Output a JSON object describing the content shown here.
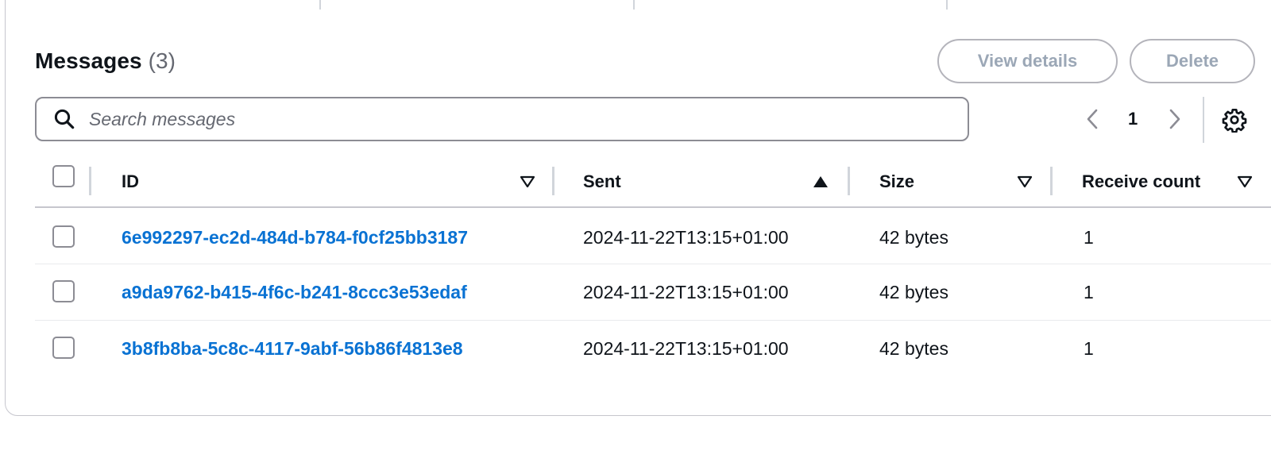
{
  "header": {
    "title": "Messages",
    "count": "(3)",
    "view_details_label": "View details",
    "delete_label": "Delete"
  },
  "search": {
    "placeholder": "Search messages",
    "value": ""
  },
  "pagination": {
    "current_page": "1"
  },
  "table": {
    "columns": [
      {
        "label": "ID",
        "sort": "none"
      },
      {
        "label": "Sent",
        "sort": "ascending"
      },
      {
        "label": "Size",
        "sort": "none"
      },
      {
        "label": "Receive count",
        "sort": "none"
      }
    ],
    "rows": [
      {
        "id": "6e992297-ec2d-484d-b784-f0cf25bb3187",
        "sent": "2024-11-22T13:15+01:00",
        "size": "42 bytes",
        "receive_count": "1"
      },
      {
        "id": "a9da9762-b415-4f6c-b241-8ccc3e53edaf",
        "sent": "2024-11-22T13:15+01:00",
        "size": "42 bytes",
        "receive_count": "1"
      },
      {
        "id": "3b8fb8ba-5c8c-4117-9abf-56b86f4813e8",
        "sent": "2024-11-22T13:15+01:00",
        "size": "42 bytes",
        "receive_count": "1"
      }
    ]
  },
  "colors": {
    "link": "#0972d3",
    "text": "#0f141a",
    "muted": "#656871",
    "disabled_button_text": "#9ba7b6",
    "border": "#c6c6cd"
  },
  "icons": {
    "search": "search-icon",
    "prev_page": "chevron-left-icon",
    "next_page": "chevron-right-icon",
    "settings": "gear-icon",
    "sort_none": "sort-caret-outline-icon",
    "sort_asc": "sort-caret-filled-up-icon"
  }
}
